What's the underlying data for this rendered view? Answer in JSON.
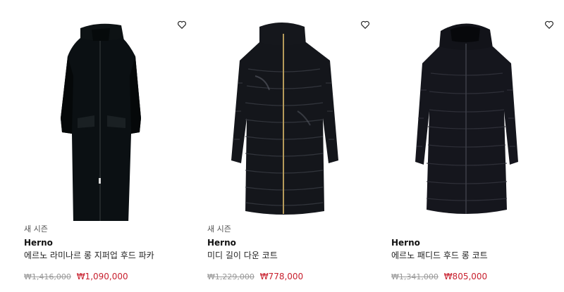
{
  "colors": {
    "accent_sale": "#c8202e",
    "muted": "#999999"
  },
  "products": [
    {
      "tag": "새 시즌",
      "brand": "Herno",
      "name": "에르노 라미나르 롱 지퍼업 후드 파카",
      "price_original": "₩1,416,000",
      "price_sale": "₩1,090,000",
      "wishlist_icon": "heart-outline-icon",
      "image": "long-black-hooded-parka"
    },
    {
      "tag": "새 시즌",
      "brand": "Herno",
      "name": "미디 길이 다운 코트",
      "price_original": "₩1,229,000",
      "price_sale": "₩778,000",
      "wishlist_icon": "heart-outline-icon",
      "image": "black-glossy-down-coat"
    },
    {
      "brand": "Herno",
      "name": "에르노 패디드 후드 롱 코트",
      "price_original": "₩1,341,000",
      "price_sale": "₩805,000",
      "wishlist_icon": "heart-outline-icon",
      "image": "black-padded-hooded-long-coat"
    }
  ]
}
